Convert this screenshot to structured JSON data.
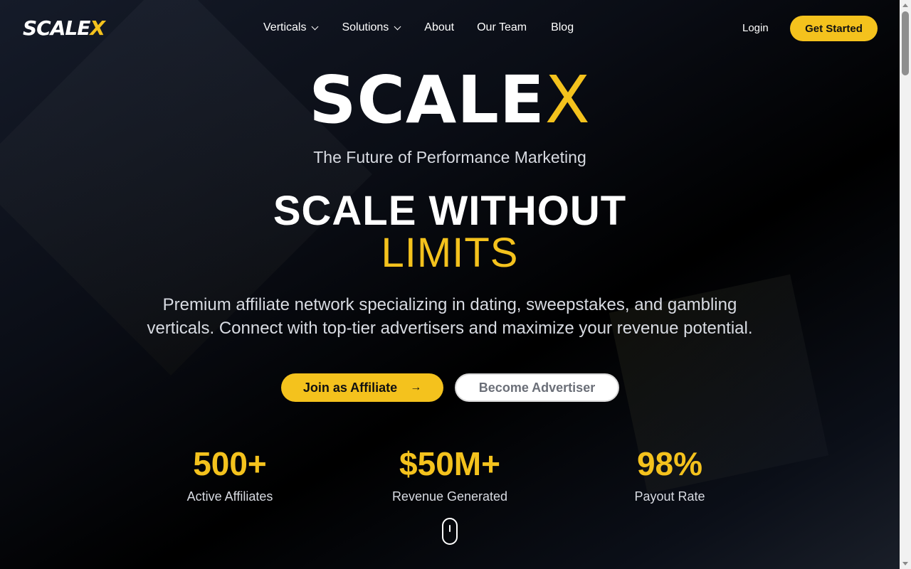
{
  "logo": {
    "main": "SCALE",
    "accent": "X"
  },
  "nav": {
    "items": [
      {
        "label": "Verticals",
        "has_dropdown": true
      },
      {
        "label": "Solutions",
        "has_dropdown": true
      },
      {
        "label": "About",
        "has_dropdown": false
      },
      {
        "label": "Our Team",
        "has_dropdown": false
      },
      {
        "label": "Blog",
        "has_dropdown": false
      }
    ],
    "login_label": "Login",
    "cta_label": "Get Started"
  },
  "hero": {
    "brand_main": "SCALE",
    "brand_accent": "X",
    "tagline": "The Future of Performance Marketing",
    "headline_line1": "SCALE WITHOUT",
    "headline_line2": "LIMITS",
    "description": "Premium affiliate network specializing in dating, sweepstakes, and gambling verticals. Connect with top-tier advertisers and maximize your revenue potential.",
    "primary_button": "Join as Affiliate",
    "primary_button_icon": "arrow-right-icon",
    "secondary_button": "Become Advertiser"
  },
  "stats": [
    {
      "value": "500+",
      "label": "Active Affiliates"
    },
    {
      "value": "$50M+",
      "label": "Revenue Generated"
    },
    {
      "value": "98%",
      "label": "Payout Rate"
    }
  ],
  "colors": {
    "accent": "#f4c21d",
    "background": "#05070c",
    "text": "#ffffff"
  }
}
